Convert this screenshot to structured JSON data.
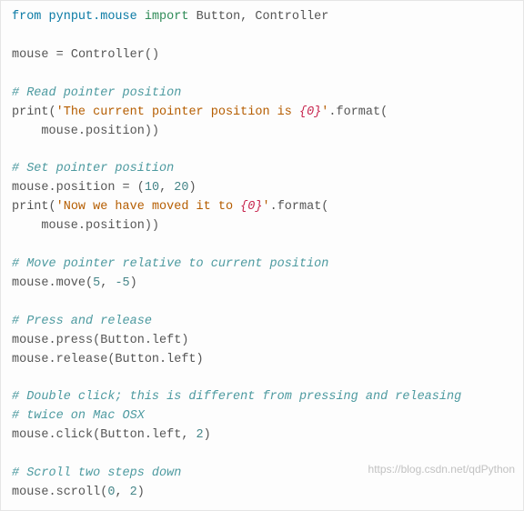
{
  "code": {
    "l1": {
      "from": "from",
      "mod": "pynput.mouse",
      "import": "import",
      "names": "Button, Controller"
    },
    "l2": "",
    "l3": {
      "lhs": "mouse",
      "eq": "=",
      "rhs": "Controller()"
    },
    "l4": "",
    "l5": "# Read pointer position",
    "l6": {
      "fn": "print",
      "open": "(",
      "str1": "'The current pointer position is ",
      "fmt": "{0}",
      "str2": "'",
      "dot": ".format("
    },
    "l7": "    mouse.position))",
    "l8": "",
    "l9": "# Set pointer position",
    "l10": {
      "lhs": "mouse.position",
      "eq": "=",
      "open": "(",
      "n1": "10",
      "comma": ", ",
      "n2": "20",
      "close": ")"
    },
    "l11": {
      "fn": "print",
      "open": "(",
      "str1": "'Now we have moved it to ",
      "fmt": "{0}",
      "str2": "'",
      "dot": ".format("
    },
    "l12": "    mouse.position))",
    "l13": "",
    "l14": "# Move pointer relative to current position",
    "l15": {
      "call": "mouse.move(",
      "n1": "5",
      "comma": ", ",
      "n2": "-5",
      "close": ")"
    },
    "l16": "",
    "l17": "# Press and release",
    "l18": "mouse.press(Button.left)",
    "l19": "mouse.release(Button.left)",
    "l20": "",
    "l21": "# Double click; this is different from pressing and releasing",
    "l22": "# twice on Mac OSX",
    "l23": {
      "call": "mouse.click(Button.left, ",
      "n": "2",
      "close": ")"
    },
    "l24": "",
    "l25": "# Scroll two steps down",
    "l26": {
      "call": "mouse.scroll(",
      "n1": "0",
      "comma": ", ",
      "n2": "2",
      "close": ")"
    }
  },
  "watermark": "https://blog.csdn.net/qdPython"
}
